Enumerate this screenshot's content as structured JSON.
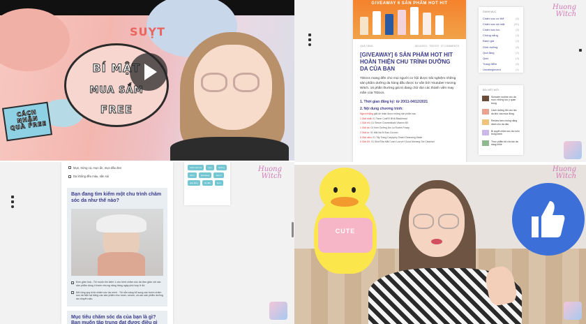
{
  "thumbnail": {
    "suyt": "SUỴT",
    "speech_lines": [
      "BÍ MẬT",
      "MUA SẮM",
      "FREE"
    ],
    "sign_lines": [
      "CÁCH NHẬN",
      "QUÀ FREE"
    ],
    "play_icon": "play-icon"
  },
  "article": {
    "banner_title": "GIVEAWAY 6 SẢN PHẨM HOT HIT",
    "meta_left": "QUÀ TẶNG",
    "meta_right": "18/11/2021 · TIDOCS · 27 COMMENTS",
    "title": "[GIVEAWAY] 6 SẢN PHẨM HOT HIT HOÀN THIỆN CHU TRÌNH DƯỠNG DA CỦA BẠN",
    "intro": "TiDocs mang đến cho mọi người cơ hội được trải nghiệm những sản phẩm dưỡng da hàng đầu được tư vấn bởi Youtuber Hương Witch. 16 phần thưởng giá trị đang chờ đợi các thành viên may mắn của TiDocs.",
    "section1": "1. Thời gian đăng ký: từ 20/11-04/12/2021",
    "section2": "2. Nội dung chương trình:",
    "lines": [
      {
        "red": "Người thắng",
        "text": " giải sẽ nhận được những sản phẩm sau"
      },
      {
        "red": "1 Giải nhất",
        "text": ": 01 Toner CosRX BHA Blackhead"
      },
      {
        "red": "1 Giải nhì",
        "text": ": 01 Serum Cosmedicals Vitamin B5"
      },
      {
        "red": "1 Giải ba",
        "text": ": 01 Kem Dưỡng Ẩm La Roche-Posay"
      },
      {
        "red": "2 Giải tư",
        "text": ": 01 Mặt Nạ Bí Đao Cocoon"
      },
      {
        "red": "5 Giải năm",
        "text": ": 01 Tẩy Trang Caryophy Smart Cleansing Water"
      },
      {
        "red": "6 Giải KK",
        "text": ": 01 Sữa Rửa Mặt Cosrx Low pH Good Morning Gel Cleanser"
      }
    ]
  },
  "sidebar": {
    "categories_title": "DANH MỤC",
    "categories": [
      {
        "label": "Chăm sóc cơ thể",
        "count": "(6)"
      },
      {
        "label": "Chăm sóc da mặt",
        "count": "(20)"
      },
      {
        "label": "Chăm sóc tóc",
        "count": "(5)"
      },
      {
        "label": "Chống nắng",
        "count": "(3)"
      },
      {
        "label": "Đánh giá",
        "count": "(4)"
      },
      {
        "label": "Dinh dưỡng",
        "count": "(8)"
      },
      {
        "label": "Quà tặng",
        "count": "(2)"
      },
      {
        "label": "Quiz",
        "count": "(3)"
      },
      {
        "label": "Trang điểm",
        "count": "(6)"
      },
      {
        "label": "Uncategorized",
        "count": "(1)"
      }
    ],
    "recent_title": "BÀI VIẾT MỚI",
    "recent_posts": [
      "Skincare routine cho da mụn: những lưu ý quan trọng",
      "Cách dưỡng ẩm cho làn da khô vào mùa đông",
      "Review kem chống nắng dành cho da dầu",
      "Bí quyết chăm sóc tóc luôn bồng bềnh",
      "Thực phẩm tốt cho làn da sáng khỏe"
    ]
  },
  "quiz": {
    "top_options": [
      "Mụn, trứng cá, mụn ẩn, mụn đầu đen",
      "Da không đều màu, sần sùi"
    ],
    "question1": "Bạn đang tìm kiếm một chu trình chăm sóc da như thế nào?",
    "answers1": [
      "Đơn giản hoá - Tôi muốn tìm kiếm 1 chu trình chăm sóc da đơn giản với các sản phẩm dùng ít bước nhưng năng hàng ngày phù hợp ở đó.",
      "Mở rộng quy trình chăm sóc da mình - Tôi sẵn sàng bổ sung các bước chăm sóc da hiện tại bằng các sản phẩm như toner, serum, và các sản phẩm dưỡng da chuyên sâu."
    ],
    "question2": "Mục tiêu chăm sóc da của bạn là gì? Bạn muốn tập trung đạt được điều gì cho làn da của mình hiện tại?",
    "tags": [
      "chăm sóc da",
      "mụn",
      "dưỡng",
      "toner",
      "giveaway",
      "serum",
      "quà tặng",
      "da dầu",
      "kem"
    ]
  },
  "watermark": [
    "Huong",
    "Witch"
  ],
  "vlog": {
    "duck_shirt": "CUTE",
    "like_icon": "thumbs-up-icon"
  }
}
